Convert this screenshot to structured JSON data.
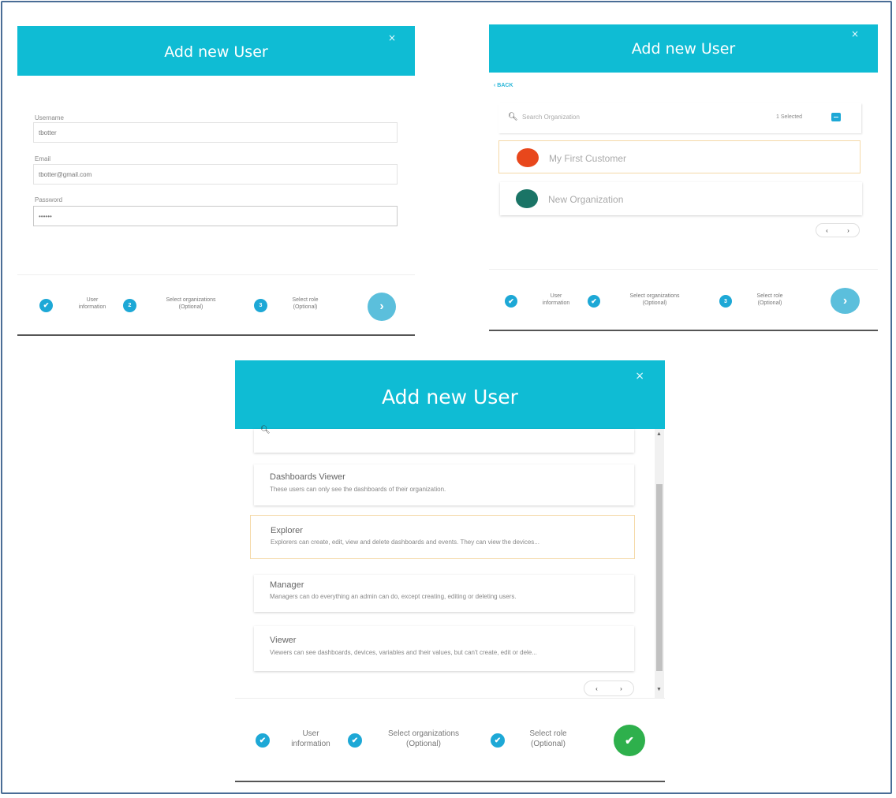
{
  "modal_title": "Add new User",
  "close_symbol": "×",
  "step1": {
    "username_label": "Username",
    "username_value": "tbotter",
    "email_label": "Email",
    "email_value": "tbotter@gmail.com",
    "password_label": "Password",
    "password_value": "••••••",
    "steps": [
      {
        "line1": "User",
        "line2": "information",
        "icon": "check-icon"
      },
      {
        "line1": "Select organizations",
        "line2": "(Optional)",
        "icon": "2"
      },
      {
        "line1": "Select role",
        "line2": "(Optional)",
        "icon": "3"
      }
    ],
    "next_symbol": "›"
  },
  "step2": {
    "back_label": "‹ BACK",
    "search_placeholder": "Search Organization",
    "selected_count": "1 Selected",
    "organizations": [
      {
        "name": "My First Customer",
        "color": "#e8471c",
        "selected": true
      },
      {
        "name": "New Organization",
        "color": "#1a7466",
        "selected": false
      }
    ],
    "steps": [
      {
        "line1": "User",
        "line2": "information",
        "icon": "check-icon"
      },
      {
        "line1": "Select organizations",
        "line2": "(Optional)",
        "icon": "check-icon"
      },
      {
        "line1": "Select role",
        "line2": "(Optional)",
        "icon": "3"
      }
    ],
    "pager_prev": "‹",
    "pager_next": "›",
    "next_symbol": "›"
  },
  "step3": {
    "roles": [
      {
        "title": "Dashboards Viewer",
        "desc": "These users can only see the dashboards of their organization.",
        "selected": false
      },
      {
        "title": "Explorer",
        "desc": "Explorers can create, edit, view and delete dashboards and events. They can view the devices...",
        "selected": true
      },
      {
        "title": "Manager",
        "desc": "Managers can do everything an admin can do, except creating, editing or deleting users.",
        "selected": false
      },
      {
        "title": "Viewer",
        "desc": "Viewers can see dashboards, devices, variables and their values, but can't create, edit or dele...",
        "selected": false
      }
    ],
    "steps": [
      {
        "line1": "User",
        "line2": "information",
        "icon": "check-icon"
      },
      {
        "line1": "Select organizations",
        "line2": "(Optional)",
        "icon": "check-icon"
      },
      {
        "line1": "Select role",
        "line2": "(Optional)",
        "icon": "check-icon"
      }
    ],
    "pager_prev": "‹",
    "pager_next": "›",
    "scroll_up": "▲",
    "scroll_down": "▼",
    "finish_symbol": "✔"
  },
  "colors": {
    "header": "#0fbcd4",
    "step_icon": "#1da8d6",
    "next_btn": "#5bbfdc",
    "finish_btn": "#2eb04c",
    "selected_border": "#f5d9a8"
  }
}
